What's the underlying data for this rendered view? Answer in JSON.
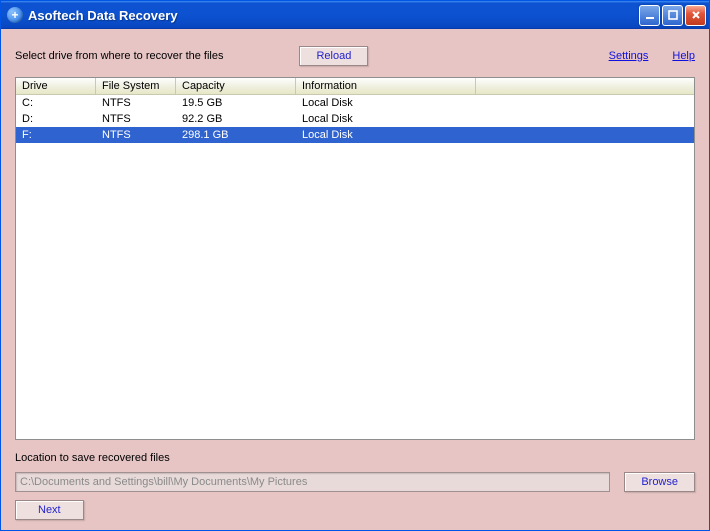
{
  "window": {
    "title": "Asoftech Data Recovery"
  },
  "topbar": {
    "prompt": "Select drive from where to recover the files",
    "reload_label": "Reload",
    "settings_label": "Settings",
    "help_label": "Help"
  },
  "columns": {
    "drive": "Drive",
    "fs": "File System",
    "capacity": "Capacity",
    "info": "Information"
  },
  "drives": [
    {
      "drive": "C:",
      "fs": "NTFS",
      "capacity": "19.5 GB",
      "info": "Local Disk",
      "selected": false
    },
    {
      "drive": "D:",
      "fs": "NTFS",
      "capacity": "92.2 GB",
      "info": "Local Disk",
      "selected": false
    },
    {
      "drive": "F:",
      "fs": "NTFS",
      "capacity": "298.1 GB",
      "info": "Local Disk",
      "selected": true
    }
  ],
  "location": {
    "label": "Location to save recovered files",
    "path": "C:\\Documents and Settings\\bill\\My Documents\\My Pictures",
    "browse_label": "Browse"
  },
  "footer": {
    "next_label": "Next"
  }
}
